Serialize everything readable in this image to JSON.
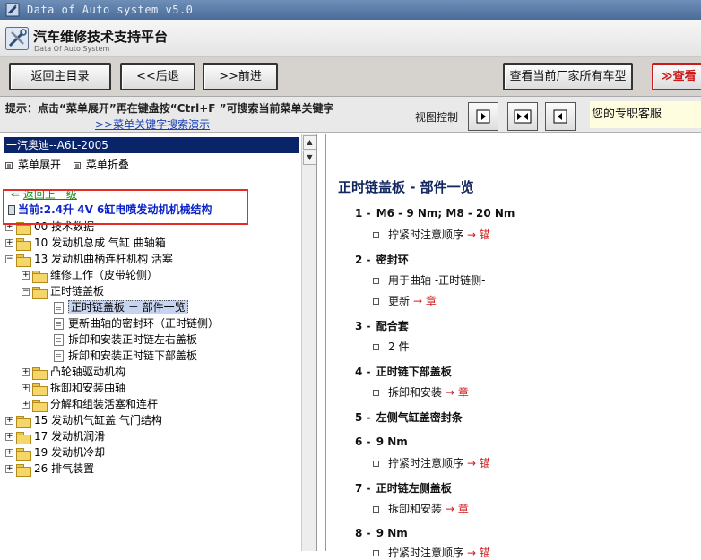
{
  "window": {
    "title": "Data of Auto system v5.0"
  },
  "brand": {
    "title_cn": "汽车维修技术支持平台",
    "title_en": "Data Of Auto System"
  },
  "toolbar": {
    "main_menu": "返回主目录",
    "back": "<<后退",
    "forward": ">>前进",
    "all_models": "查看当前厂家所有车型",
    "view_more": "查看"
  },
  "hintbar": {
    "hint": "提示：点击“菜单展开”再在键盘按“Ctrl+F ”可搜索当前菜单关键字",
    "demo_link": ">>菜单关键字搜索演示",
    "view_control": "视图控制",
    "service": "您的专职客服"
  },
  "left": {
    "vehicle": "一汽奥迪--A6L-2005",
    "expand": "菜单展开",
    "collapse": "菜单折叠",
    "back_level": "返回上一级",
    "current": "当前:2.4升  4V 6缸电喷发动机机械结构",
    "tree": [
      {
        "label": "00 技术数据"
      },
      {
        "label": "10 发动机总成 气缸 曲轴箱"
      },
      {
        "label": "13 发动机曲柄连杆机构 活塞"
      },
      {
        "label": "维修工作（皮带轮侧）"
      },
      {
        "label": "正时链盖板"
      },
      {
        "label": "正时链盖板 － 部件一览"
      },
      {
        "label": "更新曲轴的密封环（正时链侧）"
      },
      {
        "label": "拆卸和安装正时链左右盖板"
      },
      {
        "label": "拆卸和安装正时链下部盖板"
      },
      {
        "label": "凸轮轴驱动机构"
      },
      {
        "label": "拆卸和安装曲轴"
      },
      {
        "label": "分解和组装活塞和连杆"
      },
      {
        "label": "15 发动机气缸盖 气门结构"
      },
      {
        "label": "17 发动机润滑"
      },
      {
        "label": "19 发动机冷却"
      },
      {
        "label": "26 排气装置"
      }
    ]
  },
  "content": {
    "title": "正时链盖板  - 部件一览",
    "items": [
      {
        "num": "1 -",
        "head": "M6 - 9 Nm;  M8 - 20 Nm",
        "sub": "拧紧时注意顺序",
        "link": "→ 锚"
      },
      {
        "num": "2 -",
        "head": "密封环",
        "sub": "用于曲轴 -正时链侧-",
        "sub2": "更新",
        "link2": "→ 章"
      },
      {
        "num": "3 -",
        "head": "配合套",
        "sub": "2 件"
      },
      {
        "num": "4 -",
        "head": "正时链下部盖板",
        "sub": "拆卸和安装",
        "link": "→ 章"
      },
      {
        "num": "5 -",
        "head": "左侧气缸盖密封条"
      },
      {
        "num": "6 -",
        "head": "9 Nm",
        "sub": "拧紧时注意顺序",
        "link": "→ 锚"
      },
      {
        "num": "7 -",
        "head": "正时链左侧盖板",
        "sub": "拆卸和安装",
        "link": "→ 章"
      },
      {
        "num": "8 -",
        "head": "9 Nm",
        "sub": "拧紧时注意顺序",
        "link": "→ 锚"
      }
    ]
  }
}
